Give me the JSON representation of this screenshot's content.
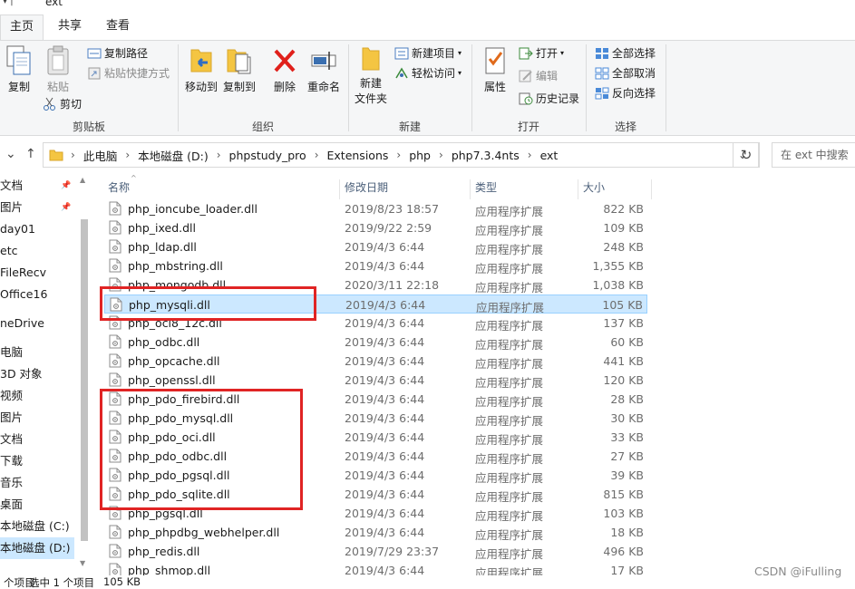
{
  "window": {
    "title": "ext"
  },
  "tabs": [
    {
      "label": "主页",
      "active": true
    },
    {
      "label": "共享",
      "active": false
    },
    {
      "label": "查看",
      "active": false
    }
  ],
  "ribbon": {
    "clipboard": {
      "copy": "复制",
      "paste": "粘贴",
      "copy_path": "复制路径",
      "paste_shortcut": "粘贴快捷方式",
      "cut": "剪切",
      "group_label": "剪贴板"
    },
    "organize": {
      "move_to": "移动到",
      "copy_to": "复制到",
      "delete": "删除",
      "rename": "重命名",
      "group_label": "组织"
    },
    "new": {
      "new_folder_line1": "新建",
      "new_folder_line2": "文件夹",
      "new_item": "新建项目",
      "easy_access": "轻松访问",
      "group_label": "新建"
    },
    "open": {
      "properties": "属性",
      "open": "打开",
      "edit": "编辑",
      "history": "历史记录",
      "group_label": "打开"
    },
    "select": {
      "select_all": "全部选择",
      "select_none": "全部取消",
      "invert": "反向选择",
      "group_label": "选择"
    }
  },
  "address": {
    "crumbs": [
      "此电脑",
      "本地磁盘 (D:)",
      "phpstudy_pro",
      "Extensions",
      "php",
      "php7.3.4nts",
      "ext"
    ],
    "search_placeholder": "在 ext 中搜索"
  },
  "navpane": {
    "items": [
      {
        "label": "文档",
        "pinned": true,
        "selected": false
      },
      {
        "label": "图片",
        "pinned": true,
        "selected": false
      },
      {
        "label": "day01",
        "pinned": false,
        "selected": false
      },
      {
        "label": "etc",
        "pinned": false,
        "selected": false
      },
      {
        "label": "FileRecv",
        "pinned": false,
        "selected": false
      },
      {
        "label": "Office16",
        "pinned": false,
        "selected": false
      },
      {
        "label": "neDrive",
        "pinned": false,
        "selected": false
      },
      {
        "label": "电脑",
        "pinned": false,
        "selected": false
      },
      {
        "label": "3D 对象",
        "pinned": false,
        "selected": false
      },
      {
        "label": "视频",
        "pinned": false,
        "selected": false
      },
      {
        "label": "图片",
        "pinned": false,
        "selected": false
      },
      {
        "label": "文档",
        "pinned": false,
        "selected": false
      },
      {
        "label": "下载",
        "pinned": false,
        "selected": false
      },
      {
        "label": "音乐",
        "pinned": false,
        "selected": false
      },
      {
        "label": "桌面",
        "pinned": false,
        "selected": false
      },
      {
        "label": "本地磁盘 (C:)",
        "pinned": false,
        "selected": false
      },
      {
        "label": "本地磁盘 (D:)",
        "pinned": false,
        "selected": true
      }
    ]
  },
  "columns": {
    "name": "名称",
    "date": "修改日期",
    "type": "类型",
    "size": "大小"
  },
  "files": [
    {
      "name": "php_ioncube_loader.dll",
      "date": "2019/8/23 18:57",
      "type": "应用程序扩展",
      "size": "822 KB",
      "selected": false
    },
    {
      "name": "php_ixed.dll",
      "date": "2019/9/22 2:59",
      "type": "应用程序扩展",
      "size": "109 KB",
      "selected": false
    },
    {
      "name": "php_ldap.dll",
      "date": "2019/4/3 6:44",
      "type": "应用程序扩展",
      "size": "248 KB",
      "selected": false
    },
    {
      "name": "php_mbstring.dll",
      "date": "2019/4/3 6:44",
      "type": "应用程序扩展",
      "size": "1,355 KB",
      "selected": false
    },
    {
      "name": "php_mongodb.dll",
      "date": "2020/3/11 22:18",
      "type": "应用程序扩展",
      "size": "1,038 KB",
      "selected": false
    },
    {
      "name": "php_mysqli.dll",
      "date": "2019/4/3 6:44",
      "type": "应用程序扩展",
      "size": "105 KB",
      "selected": true
    },
    {
      "name": "php_oci8_12c.dll",
      "date": "2019/4/3 6:44",
      "type": "应用程序扩展",
      "size": "137 KB",
      "selected": false
    },
    {
      "name": "php_odbc.dll",
      "date": "2019/4/3 6:44",
      "type": "应用程序扩展",
      "size": "60 KB",
      "selected": false
    },
    {
      "name": "php_opcache.dll",
      "date": "2019/4/3 6:44",
      "type": "应用程序扩展",
      "size": "441 KB",
      "selected": false
    },
    {
      "name": "php_openssl.dll",
      "date": "2019/4/3 6:44",
      "type": "应用程序扩展",
      "size": "120 KB",
      "selected": false
    },
    {
      "name": "php_pdo_firebird.dll",
      "date": "2019/4/3 6:44",
      "type": "应用程序扩展",
      "size": "28 KB",
      "selected": false
    },
    {
      "name": "php_pdo_mysql.dll",
      "date": "2019/4/3 6:44",
      "type": "应用程序扩展",
      "size": "30 KB",
      "selected": false
    },
    {
      "name": "php_pdo_oci.dll",
      "date": "2019/4/3 6:44",
      "type": "应用程序扩展",
      "size": "33 KB",
      "selected": false
    },
    {
      "name": "php_pdo_odbc.dll",
      "date": "2019/4/3 6:44",
      "type": "应用程序扩展",
      "size": "27 KB",
      "selected": false
    },
    {
      "name": "php_pdo_pgsql.dll",
      "date": "2019/4/3 6:44",
      "type": "应用程序扩展",
      "size": "39 KB",
      "selected": false
    },
    {
      "name": "php_pdo_sqlite.dll",
      "date": "2019/4/3 6:44",
      "type": "应用程序扩展",
      "size": "815 KB",
      "selected": false
    },
    {
      "name": "php_pgsql.dll",
      "date": "2019/4/3 6:44",
      "type": "应用程序扩展",
      "size": "103 KB",
      "selected": false
    },
    {
      "name": "php_phpdbg_webhelper.dll",
      "date": "2019/4/3 6:44",
      "type": "应用程序扩展",
      "size": "18 KB",
      "selected": false
    },
    {
      "name": "php_redis.dll",
      "date": "2019/7/29 23:37",
      "type": "应用程序扩展",
      "size": "496 KB",
      "selected": false
    },
    {
      "name": "php_shmop.dll",
      "date": "2019/4/3 6:44",
      "type": "应用程序扩展",
      "size": "17 KB",
      "selected": false
    }
  ],
  "status": {
    "item_count": "个项目",
    "selected": "选中 1 个项目",
    "selected_size": "105 KB"
  },
  "watermark": "CSDN @iFulling",
  "colors": {
    "selection_bg": "#cce8ff",
    "selection_border": "#99d1ff",
    "highlight_box": "#e02424",
    "ribbon_bg": "#f5f6f7"
  }
}
